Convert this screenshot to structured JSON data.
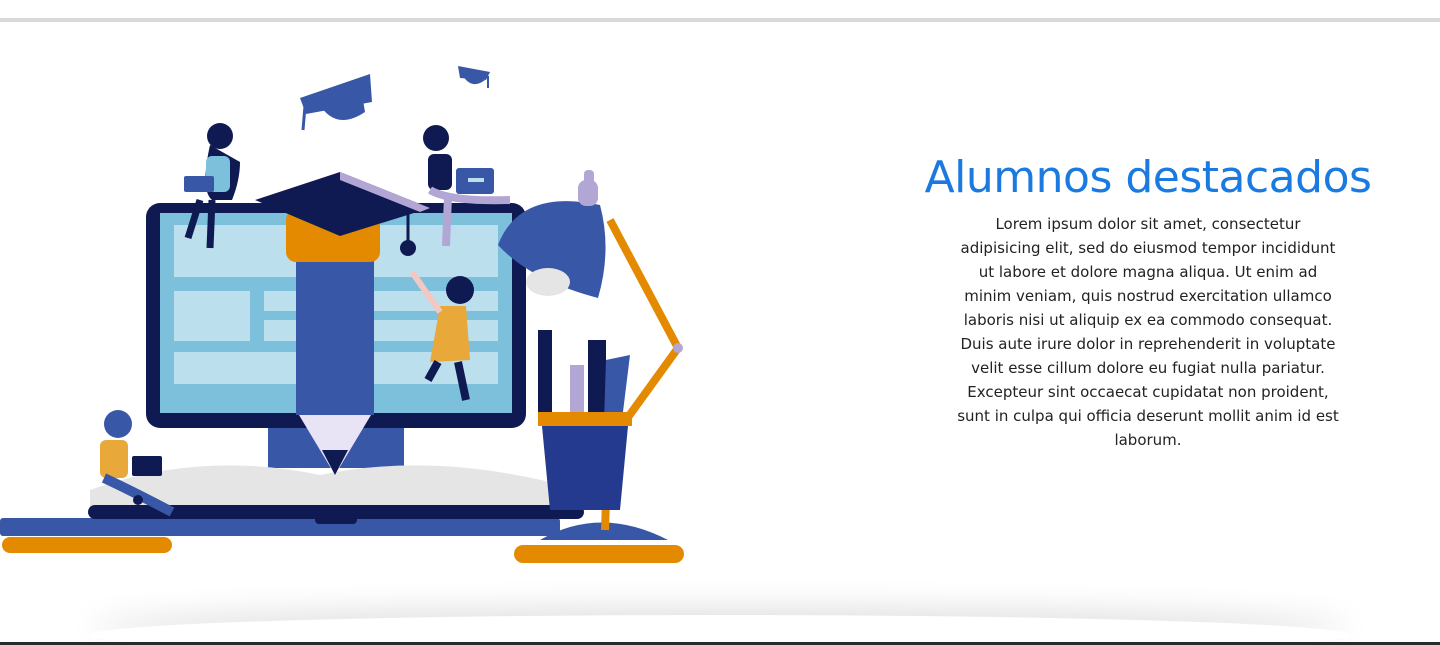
{
  "section": {
    "title": "Alumnos destacados",
    "body": "Lorem ipsum dolor sit amet, consectetur adipisicing elit, sed do eiusmod tempor incididunt ut labore et dolore magna aliqua. Ut enim ad minim veniam, quis nostrud exercitation ullamco laboris nisi ut aliquip ex ea commodo consequat. Duis aute irure dolor in reprehenderit in voluptate velit esse cillum dolore eu fugiat nulla pariatur. Excepteur sint occaecat cupidatat non proident, sunt in culpa qui officia deserunt mollit anim id est laborum."
  },
  "illustration": {
    "icon": "education-illustration",
    "colors": {
      "navy": "#101a52",
      "blue": "#3857a6",
      "light_blue": "#bcdfee",
      "screen_blue": "#7dc0db",
      "orange": "#e48a00",
      "grey": "#e5e5e5",
      "lavender": "#b2a6d4"
    }
  },
  "colors": {
    "accent": "#1a7ae0",
    "text": "#222222",
    "rule": "#d9d9d9"
  }
}
